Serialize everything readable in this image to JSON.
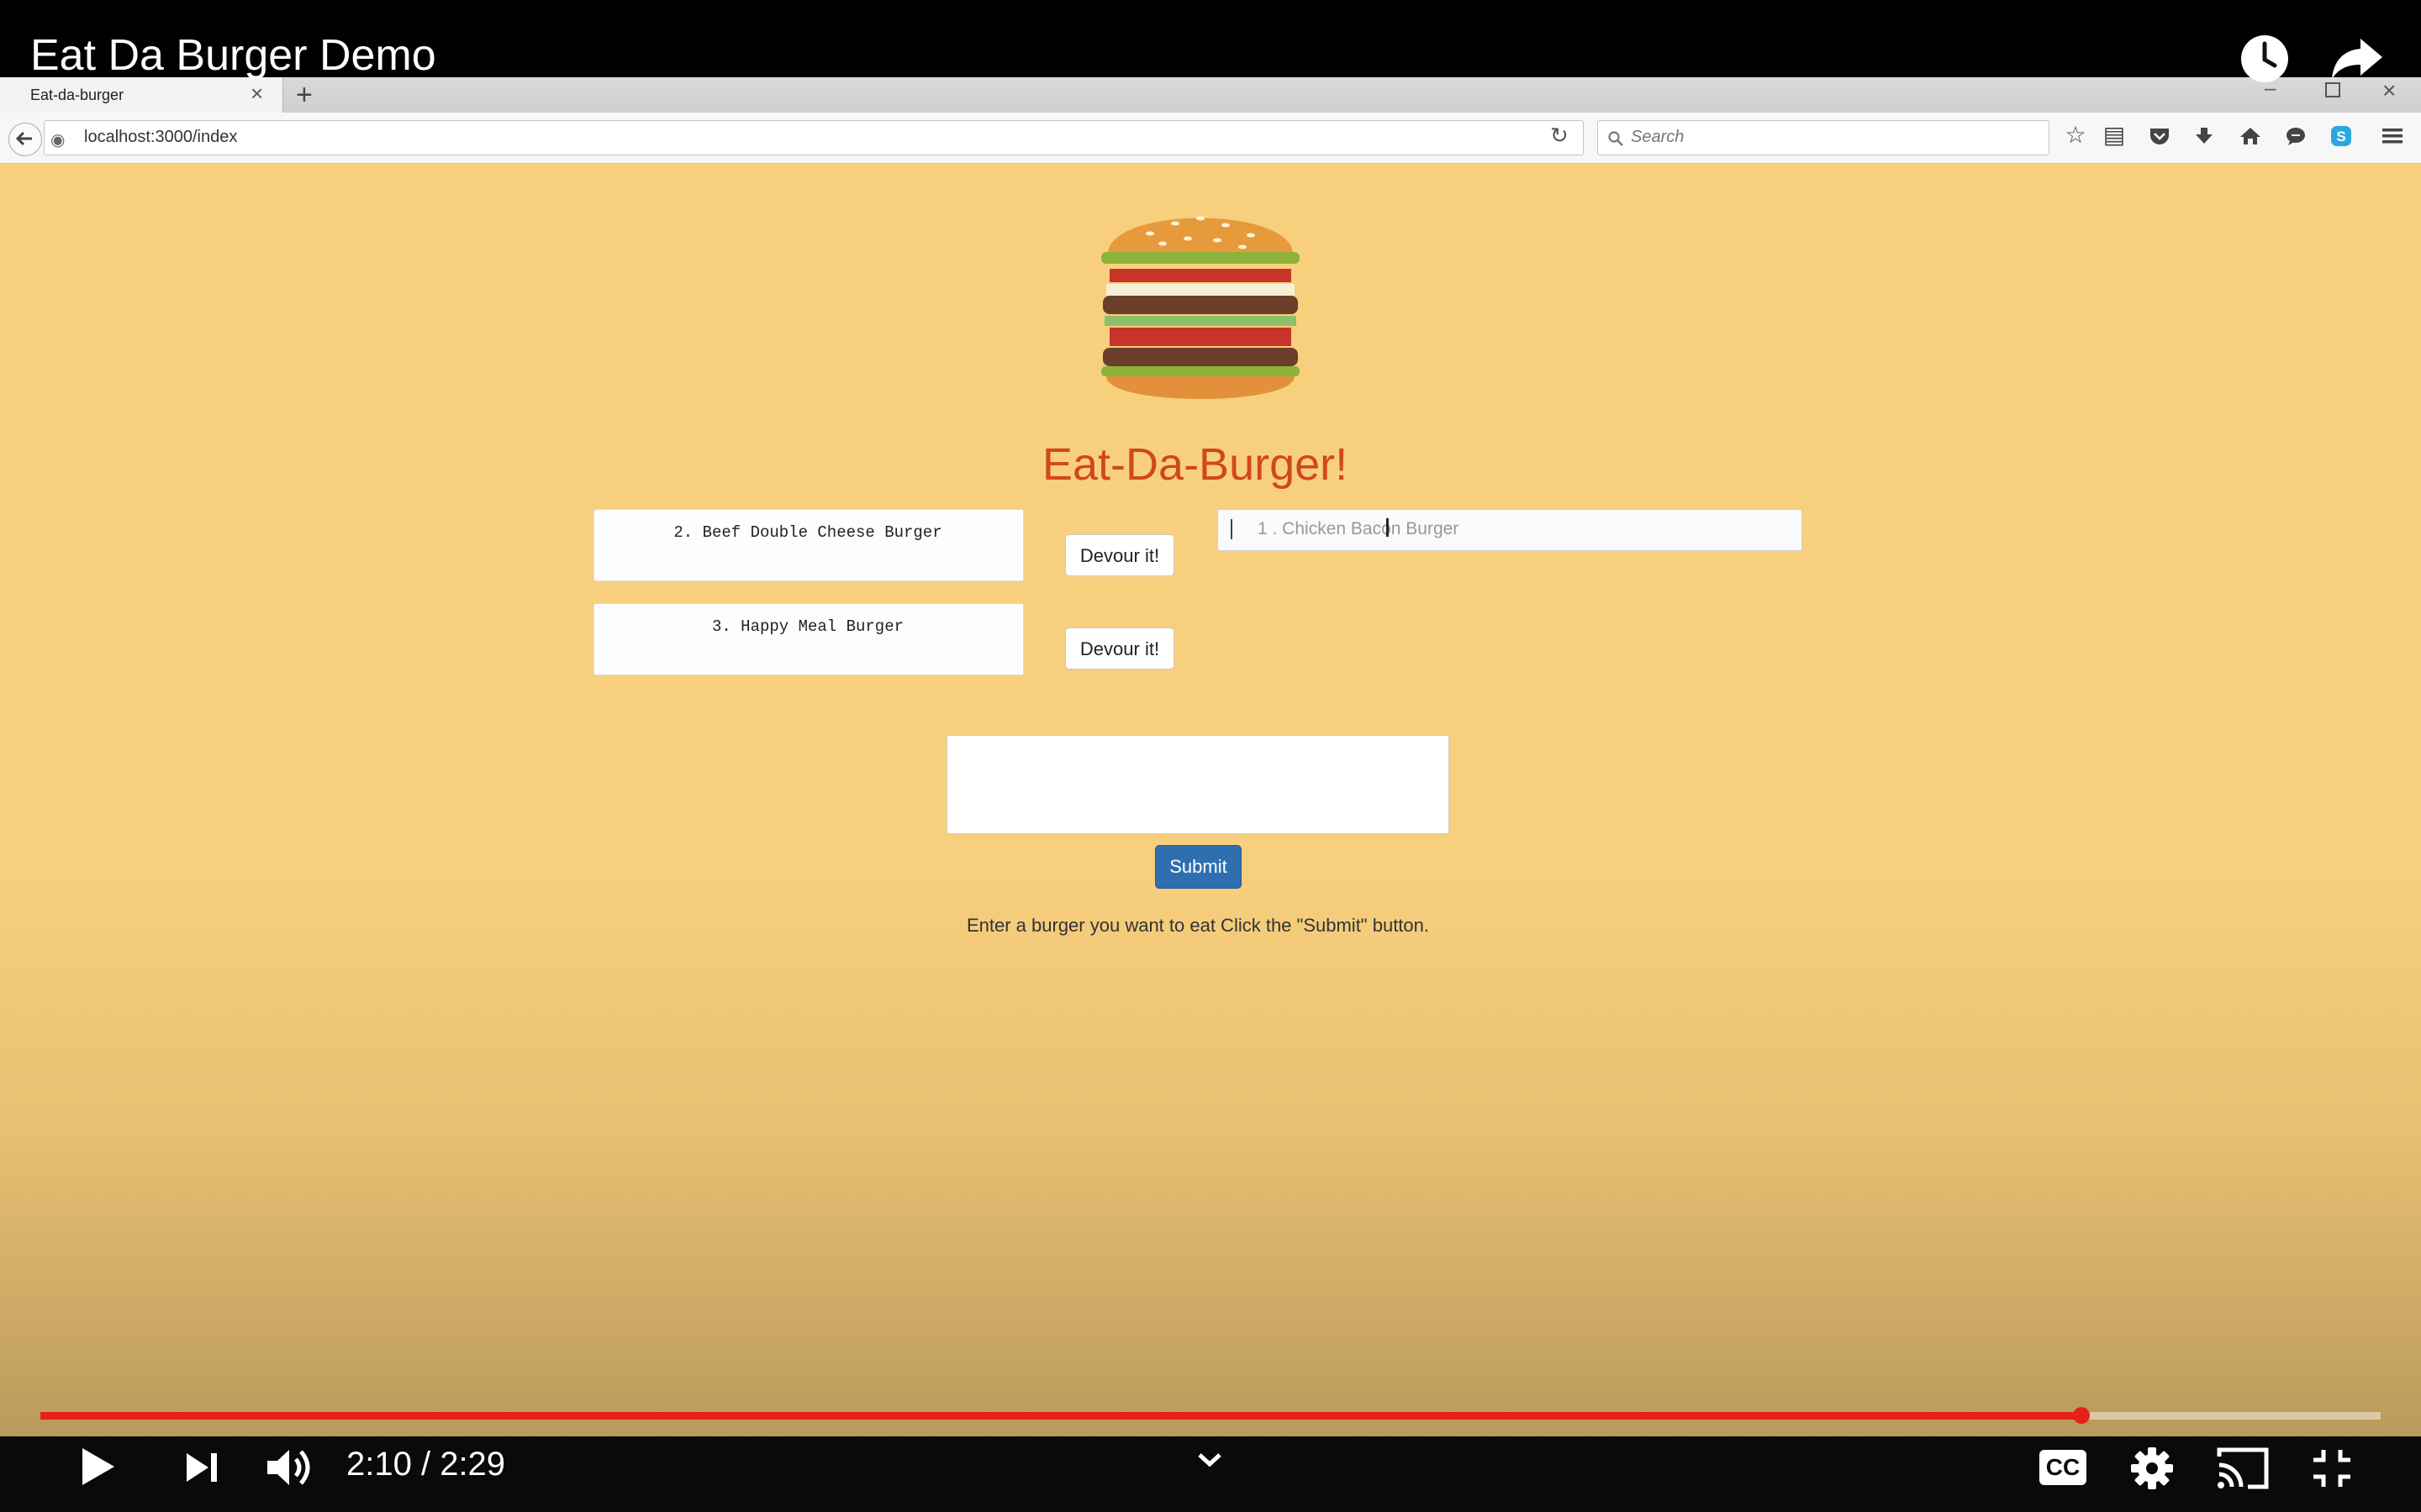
{
  "player": {
    "title": "Eat Da Burger Demo",
    "time": "2:10 / 2:29",
    "progress_fraction": 0.872,
    "accent_color": "#e62117",
    "icons": [
      "watch-later-icon",
      "share-icon",
      "play-icon",
      "next-icon",
      "volume-icon",
      "chevron-down-icon",
      "captions-icon",
      "settings-icon",
      "cast-icon",
      "exit-fullscreen-icon"
    ],
    "cc_label": "CC"
  },
  "browser": {
    "tab_label": "Eat-da-burger",
    "url": "localhost:3000/index",
    "search_placeholder": "Search"
  },
  "app": {
    "heading": "Eat-Da-Burger!",
    "burgers": [
      {
        "label": "2. Beef Double Cheese Burger",
        "button": "Devour it!"
      },
      {
        "label": "3. Happy Meal Burger",
        "button": "Devour it!"
      }
    ],
    "input_placeholder": "1 . Chicken Bacon Burger",
    "submit_label": "Submit",
    "instructions": "Enter a burger you want to eat Click the \"Submit\" button."
  }
}
